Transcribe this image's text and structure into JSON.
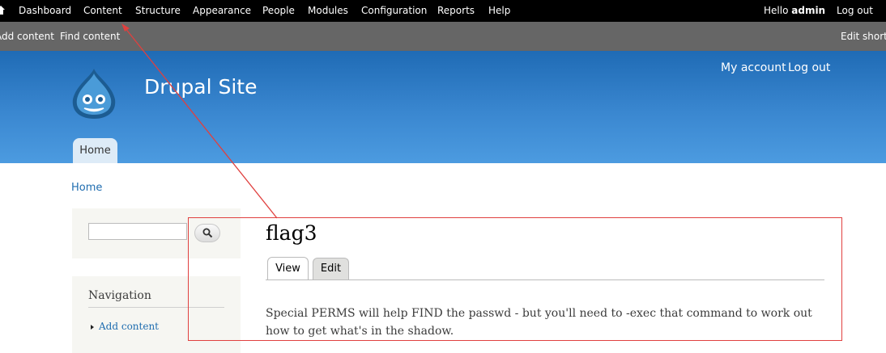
{
  "toolbar": {
    "items": [
      "Dashboard",
      "Content",
      "Structure",
      "Appearance",
      "People",
      "Modules",
      "Configuration",
      "Reports",
      "Help"
    ],
    "greeting": "Hello",
    "user": "admin",
    "logout": "Log out"
  },
  "shortcuts": {
    "items": [
      "Add content",
      "Find content"
    ],
    "edit": "Edit shortcuts"
  },
  "header": {
    "site_name": "Drupal Site",
    "secondary_links": [
      "My account",
      "Log out"
    ],
    "main_tab": "Home"
  },
  "breadcrumb": "Home",
  "sidebar": {
    "search_value": "",
    "navigation": {
      "title": "Navigation",
      "items": [
        "Add content"
      ]
    }
  },
  "node": {
    "title": "flag3",
    "tabs": [
      "View",
      "Edit"
    ],
    "body": "Special PERMS will help FIND the passwd - but you'll need to -exec that command to work out how to get what's in the shadow."
  },
  "colors": {
    "link": "#1f6db0",
    "header_top": "#1f6bb5",
    "annotation": "#e0403f"
  }
}
